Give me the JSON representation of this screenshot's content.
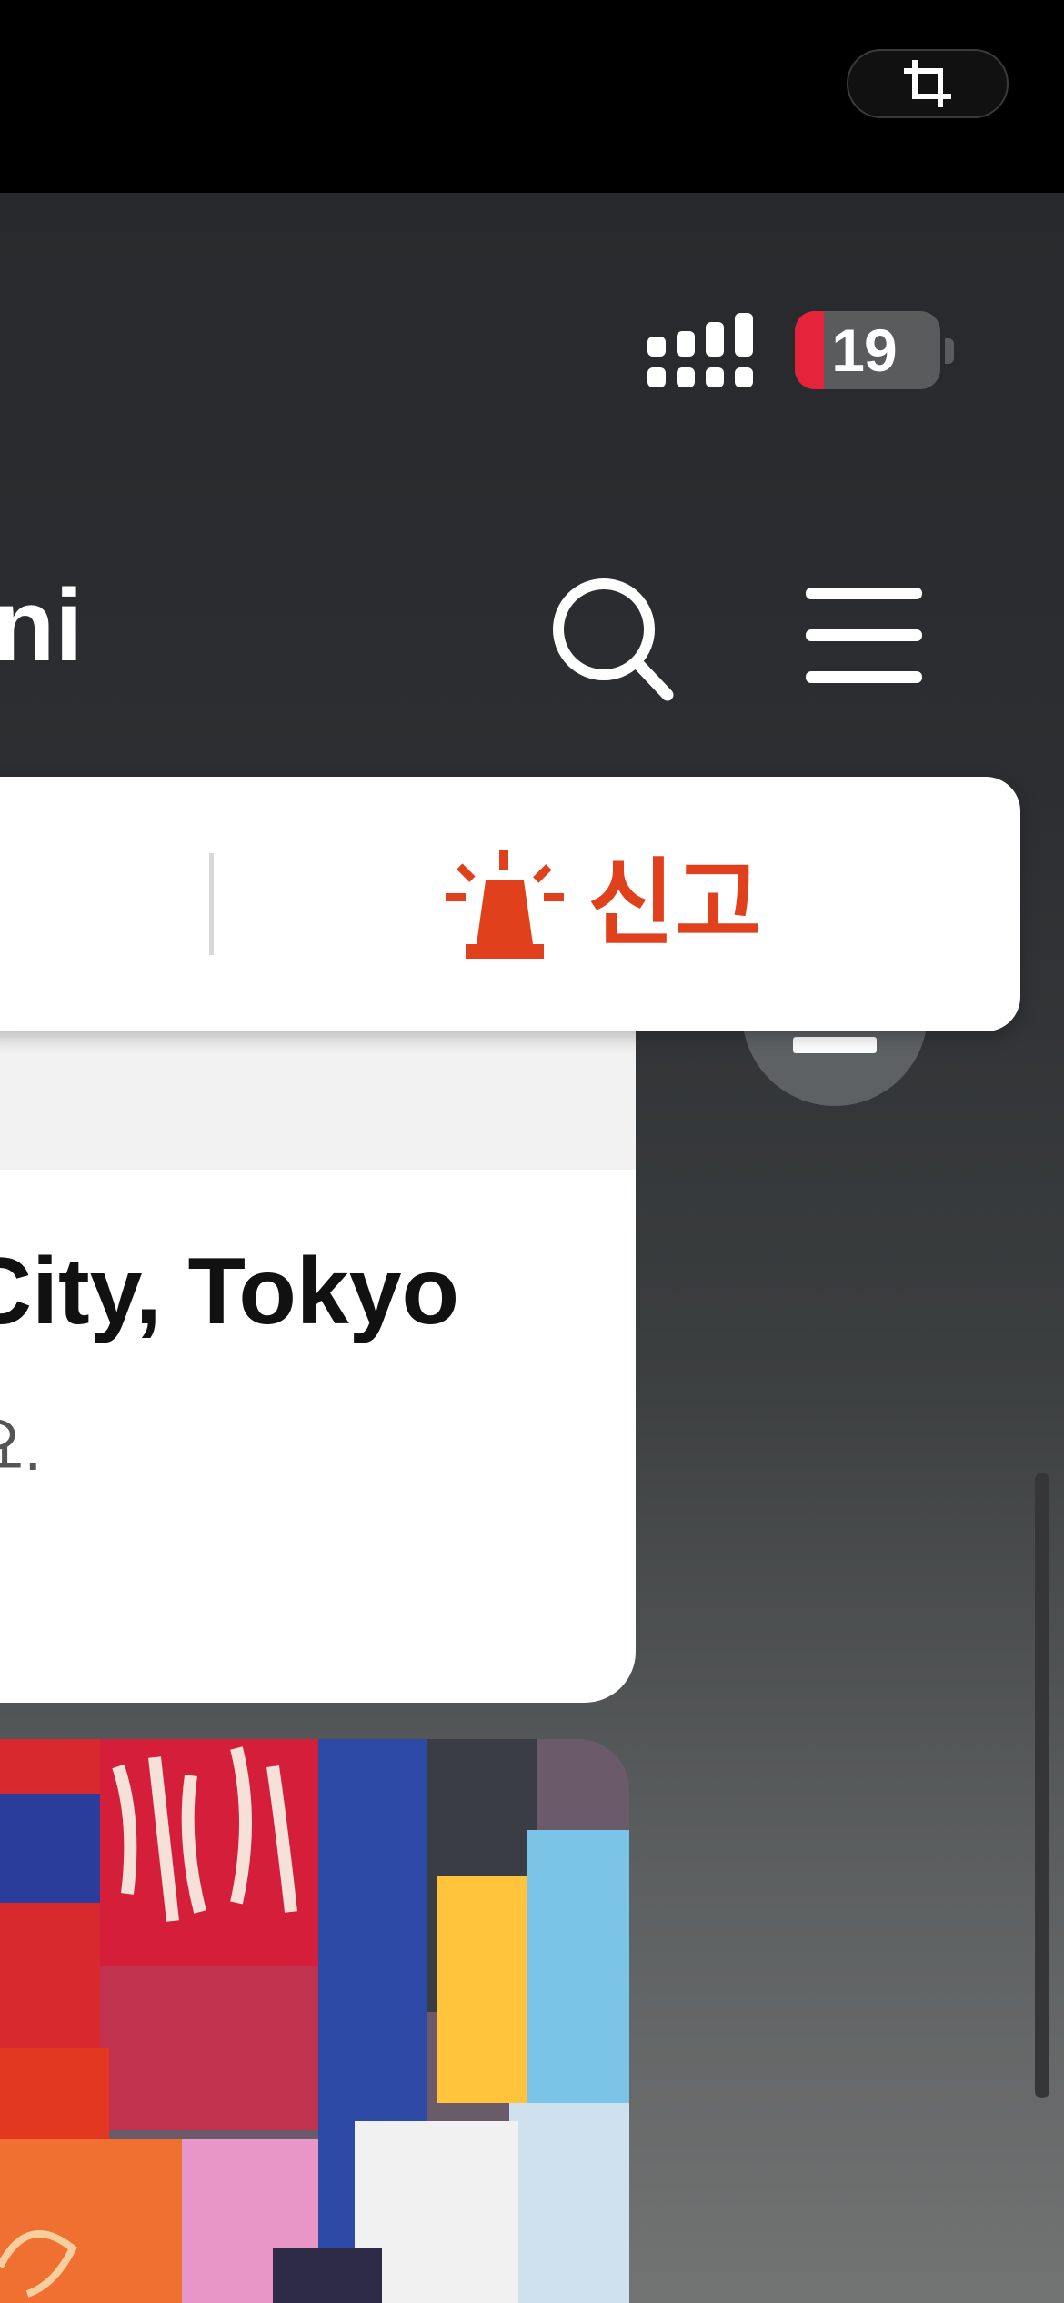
{
  "crop_tool": {
    "icon": "crop-icon"
  },
  "status_bar": {
    "signal_icon": "signal-bars-icon",
    "battery_level": "19",
    "battery_color": "#e5243b"
  },
  "header": {
    "title_partial": "ni",
    "search_icon": "search-icon",
    "menu_icon": "hamburger-menu-icon"
  },
  "popup": {
    "report_icon": "siren-icon",
    "report_label": "신고",
    "accent_color": "#e0401b"
  },
  "card": {
    "title": "City, Tokyo",
    "subtitle": "요."
  },
  "photo": {
    "description_icon": "photo-thumbnail"
  }
}
